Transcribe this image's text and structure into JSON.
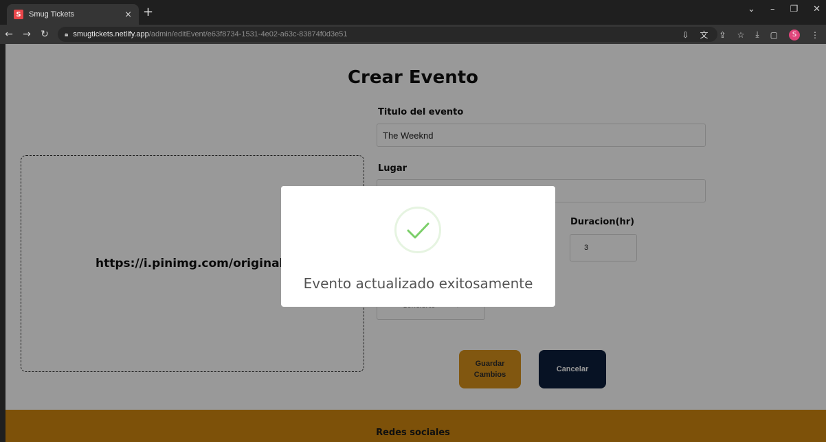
{
  "browser": {
    "tab_title": "Smug Tickets",
    "favicon_letter": "S",
    "tab_close": "×",
    "new_tab": "+",
    "url_host": "smugtickets.netlify.app",
    "url_path": "/admin/editEvent/e63f8734-1531-4e02-a63c-83874f0d3e51",
    "profile_initial": "S",
    "icons": [
      "back-icon",
      "forward-icon",
      "reload-icon",
      "lock-icon",
      "install-icon",
      "translate-icon",
      "share-icon",
      "star-icon",
      "download-icon",
      "sidebar-icon",
      "profile-icon",
      "menu-icon"
    ]
  },
  "form": {
    "title": "Crear Evento",
    "image_url": "https://i.pinimg.com/originals",
    "titulo_label": "Titulo del evento",
    "titulo_value": "The Weeknd",
    "lugar_label": "Lugar",
    "lugar_value": "",
    "duracion_label": "Duracion(hr)",
    "duracion_value": "3",
    "categoria_value": "Concierto",
    "save_label_line1": "Guardar",
    "save_label_line2": "Cambios",
    "cancel_label": "Cancelar"
  },
  "footer": {
    "title": "Redes sociales"
  },
  "modal": {
    "message": "Evento actualizado exitosamente"
  },
  "colors": {
    "save_button": "#d7911c",
    "cancel_button": "#0d1f3c",
    "footer": "#d1870f",
    "success": "#7ccf6a"
  }
}
